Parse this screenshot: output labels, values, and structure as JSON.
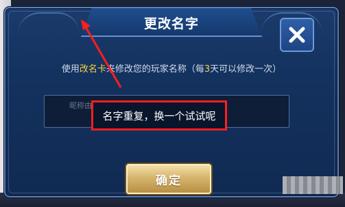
{
  "dialog": {
    "title": "更改名字",
    "hint_prefix": "使用",
    "hint_card": "改名卡",
    "hint_mid": "来修改您的玩家名称（每",
    "hint_days": "3",
    "hint_suffix": "天可以修改一次）",
    "input_placeholder": "昵称由数字和文字组成",
    "toast_message": "名字重复，换一个试试呢",
    "confirm_label": "确定",
    "close_icon": "close-x-icon"
  },
  "colors": {
    "accent_yellow": "#f5d440",
    "highlight_red": "#ff1e1e",
    "confirm_gold": "#d6b56d",
    "dialog_blue": "#14325f"
  }
}
